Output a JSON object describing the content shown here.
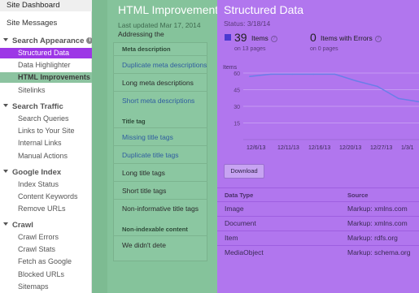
{
  "sidebar": {
    "dashboard": "Site Dashboard",
    "messages": "Site Messages",
    "sections": [
      {
        "title": "Search Appearance",
        "has_info": true,
        "info_icon": "info-icon",
        "items": [
          {
            "label": "Structured Data",
            "state": "active-purple"
          },
          {
            "label": "Data Highlighter",
            "state": ""
          },
          {
            "label": "HTML Improvements",
            "state": "active-green"
          },
          {
            "label": "Sitelinks",
            "state": ""
          }
        ]
      },
      {
        "title": "Search Traffic",
        "has_info": false,
        "items": [
          {
            "label": "Search Queries",
            "state": ""
          },
          {
            "label": "Links to Your Site",
            "state": ""
          },
          {
            "label": "Internal Links",
            "state": ""
          },
          {
            "label": "Manual Actions",
            "state": ""
          }
        ]
      },
      {
        "title": "Google Index",
        "has_info": false,
        "items": [
          {
            "label": "Index Status",
            "state": ""
          },
          {
            "label": "Content Keywords",
            "state": ""
          },
          {
            "label": "Remove URLs",
            "state": ""
          }
        ]
      },
      {
        "title": "Crawl",
        "has_info": false,
        "items": [
          {
            "label": "Crawl Errors",
            "state": ""
          },
          {
            "label": "Crawl Stats",
            "state": ""
          },
          {
            "label": "Fetch as Google",
            "state": ""
          },
          {
            "label": "Blocked URLs",
            "state": ""
          },
          {
            "label": "Sitemaps",
            "state": ""
          }
        ]
      }
    ]
  },
  "html_improvements": {
    "title": "HTML Improvements",
    "last_updated": "Last updated Mar 17, 2014",
    "addressing": "Addressing the",
    "groups": [
      {
        "heading": "Meta description",
        "rows": [
          {
            "label": "Duplicate meta descriptions",
            "link": true
          },
          {
            "label": "Long meta descriptions",
            "link": false
          },
          {
            "label": "Short meta descriptions",
            "link": true
          }
        ]
      },
      {
        "heading": "Title tag",
        "rows": [
          {
            "label": "Missing title tags",
            "link": true
          },
          {
            "label": "Duplicate title tags",
            "link": true
          },
          {
            "label": "Long title tags",
            "link": false
          },
          {
            "label": "Short title tags",
            "link": false
          },
          {
            "label": "Non-informative title tags",
            "link": false
          }
        ]
      },
      {
        "heading": "Non-indexable content",
        "rows": [
          {
            "label": "We didn't dete",
            "link": false
          }
        ]
      }
    ]
  },
  "structured_data": {
    "title": "Structured Data",
    "status": "Status: 3/18/14",
    "items_count": "39",
    "items_label": "Items",
    "items_sub": "on 13 pages",
    "errors_count": "0",
    "errors_label": "Items with Errors",
    "errors_sub": "on 0 pages",
    "help_icon": "help-icon",
    "download_label": "Download",
    "table": {
      "headers": [
        "Data Type",
        "Source"
      ],
      "rows": [
        [
          "Image",
          "Markup: xmlns.com"
        ],
        [
          "Document",
          "Markup: xmlns.com"
        ],
        [
          "Item",
          "Markup: rdfs.org"
        ],
        [
          "MediaObject",
          "Markup: schema.org"
        ]
      ]
    },
    "colors": {
      "series": "#6a7ee8",
      "accent_square": "#4a3ad0"
    }
  },
  "chart_data": {
    "type": "line",
    "ylabel": "Items",
    "ylim": [
      0,
      60
    ],
    "y_ticks": [
      "60",
      "45",
      "30",
      "15"
    ],
    "x_ticks": [
      "12/6/13",
      "12/11/13",
      "12/16/13",
      "12/20/13",
      "12/27/13",
      "1/3/1"
    ],
    "series": [
      {
        "x": [
          "12/6/13",
          "12/9/13",
          "12/11/13",
          "12/16/13",
          "12/20/13",
          "12/23/13",
          "12/27/13",
          "12/30/13",
          "1/3/14"
        ],
        "values": [
          57,
          59,
          59,
          59,
          59,
          53,
          48,
          37,
          34
        ]
      }
    ],
    "grid": true
  }
}
